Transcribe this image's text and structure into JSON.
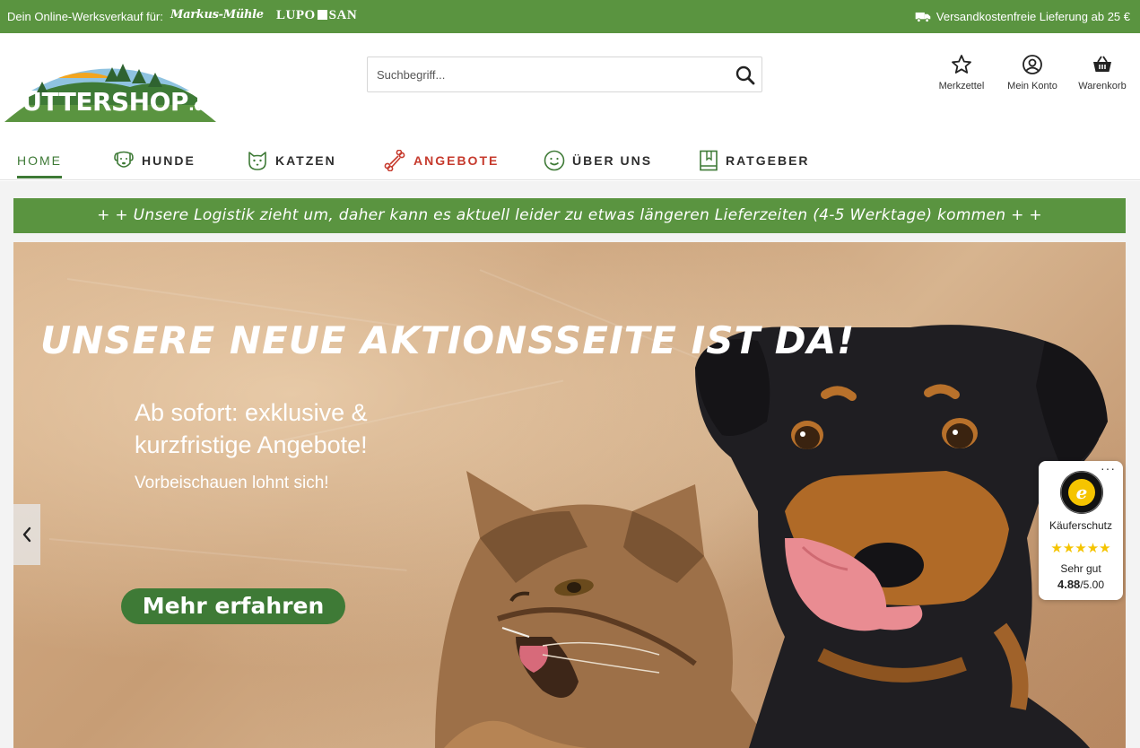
{
  "topbar": {
    "left_text": "Dein Online-Werksverkauf für:",
    "brand1": "Markus-Mühle",
    "brand2_a": "LUPO",
    "brand2_b": "SAN",
    "shipping_text": "Versandkostenfreie Lieferung ab 25 €"
  },
  "logo": {
    "main": "FUTTERSHOP",
    "tld": ".de"
  },
  "search": {
    "placeholder": "Suchbegriff..."
  },
  "header_actions": [
    {
      "label": "Merkzettel",
      "icon": "star-icon"
    },
    {
      "label": "Mein Konto",
      "icon": "user-icon"
    },
    {
      "label": "Warenkorb",
      "icon": "basket-icon"
    }
  ],
  "nav": {
    "items": [
      {
        "label": "HOME",
        "icon": ""
      },
      {
        "label": "HUNDE",
        "icon": "dog-icon"
      },
      {
        "label": "KATZEN",
        "icon": "cat-icon"
      },
      {
        "label": "ANGEBOTE",
        "icon": "bone-icon"
      },
      {
        "label": "ÜBER UNS",
        "icon": "smiley-icon"
      },
      {
        "label": "RATGEBER",
        "icon": "book-icon"
      }
    ]
  },
  "notice": "+ + Unsere Logistik zieht um, daher kann es aktuell leider zu etwas längeren Lieferzeiten (4-5 Werktage) kommen + +",
  "hero": {
    "title": "UNSERE NEUE AKTIONSSEITE IST DA!",
    "subtitle": "Ab sofort: exklusive & kurzfristige Angebote!",
    "small": "Vorbeischauen lohnt sich!",
    "cta": "Mehr erfahren"
  },
  "trusted_shops": {
    "dots": "···",
    "label": "Käuferschutz",
    "stars": "★★★★★",
    "rating_word": "Sehr gut",
    "score": "4.88",
    "score_max": "/5.00"
  },
  "colors": {
    "brand_green": "#5a9440",
    "dark_green": "#3e7a36",
    "offer_red": "#c63a2d",
    "star_yellow": "#f5c400"
  }
}
